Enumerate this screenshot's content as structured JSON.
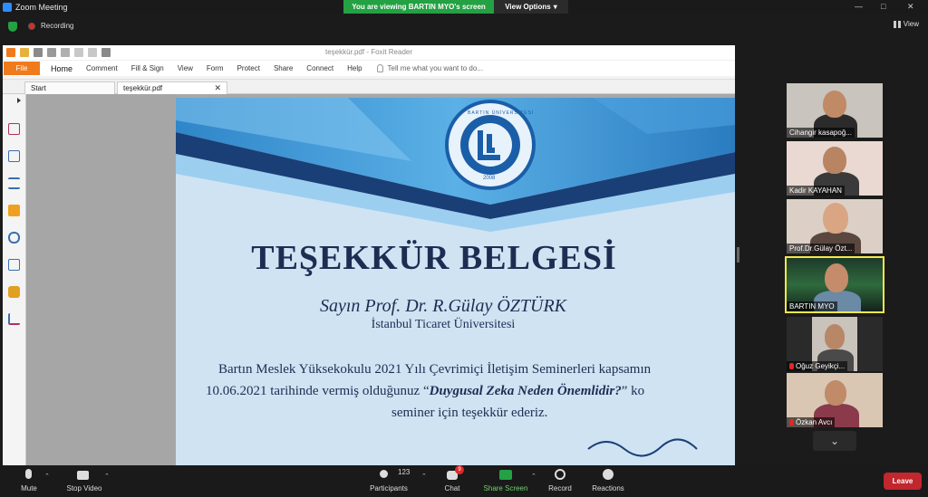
{
  "window": {
    "title": "Zoom Meeting",
    "viewing_banner": "You are viewing BARTIN MYO's screen",
    "view_options": "View Options",
    "view_label": "View"
  },
  "status": {
    "recording": "Recording"
  },
  "foxit": {
    "title": "teşekkür.pdf - Foxit Reader",
    "file_tab": "File",
    "menus": [
      "Home",
      "Comment",
      "Fill & Sign",
      "View",
      "Form",
      "Protect",
      "Share",
      "Connect",
      "Help"
    ],
    "tell_me": "Tell me what you want to do...",
    "tabs": [
      "Start",
      "teşekkür.pdf"
    ]
  },
  "certificate": {
    "university_seal_text": "BARTIN ÜNİVERSİTESİ",
    "seal_year": "2008",
    "title": "TEŞEKKÜR BELGESİ",
    "recipient": "Sayın Prof. Dr. R.Gülay ÖZTÜRK",
    "institution": "İstanbul Ticaret Üniversitesi",
    "line1": "Bartın Meslek Yüksekokulu 2021 Yılı Çevrimiçi İletişim Seminerleri kapsamın",
    "line2_prefix": "10.06.2021 tarihinde vermiş olduğunuz “",
    "line2_topic": "Duygusal Zeka Neden Önemlidir?",
    "line2_suffix": "” ko",
    "line3": "seminer için teşekkür ederiz."
  },
  "participants": [
    {
      "name": "Cihangir kasapoğ...",
      "muted": false
    },
    {
      "name": "Kadir KAYAHAN",
      "muted": false
    },
    {
      "name": "Prof.Dr.Gülay Özt...",
      "muted": false
    },
    {
      "name": "BARTIN MYO",
      "muted": false,
      "active": true
    },
    {
      "name": "Oğuz Geyikçi...",
      "muted": true
    },
    {
      "name": "Özkan Avcı",
      "muted": true
    }
  ],
  "toolbar": {
    "mute": "Mute",
    "stop_video": "Stop Video",
    "participants": "Participants",
    "participant_count": "123",
    "chat": "Chat",
    "chat_badge": "9",
    "share_screen": "Share Screen",
    "record": "Record",
    "reactions": "Reactions",
    "leave": "Leave"
  },
  "colors": {
    "share_green": "#23a143",
    "leave_red": "#c1272d",
    "foxit_orange": "#f07b1d",
    "cert_navy": "#1d2d52",
    "active_speaker": "#f4e84a"
  }
}
